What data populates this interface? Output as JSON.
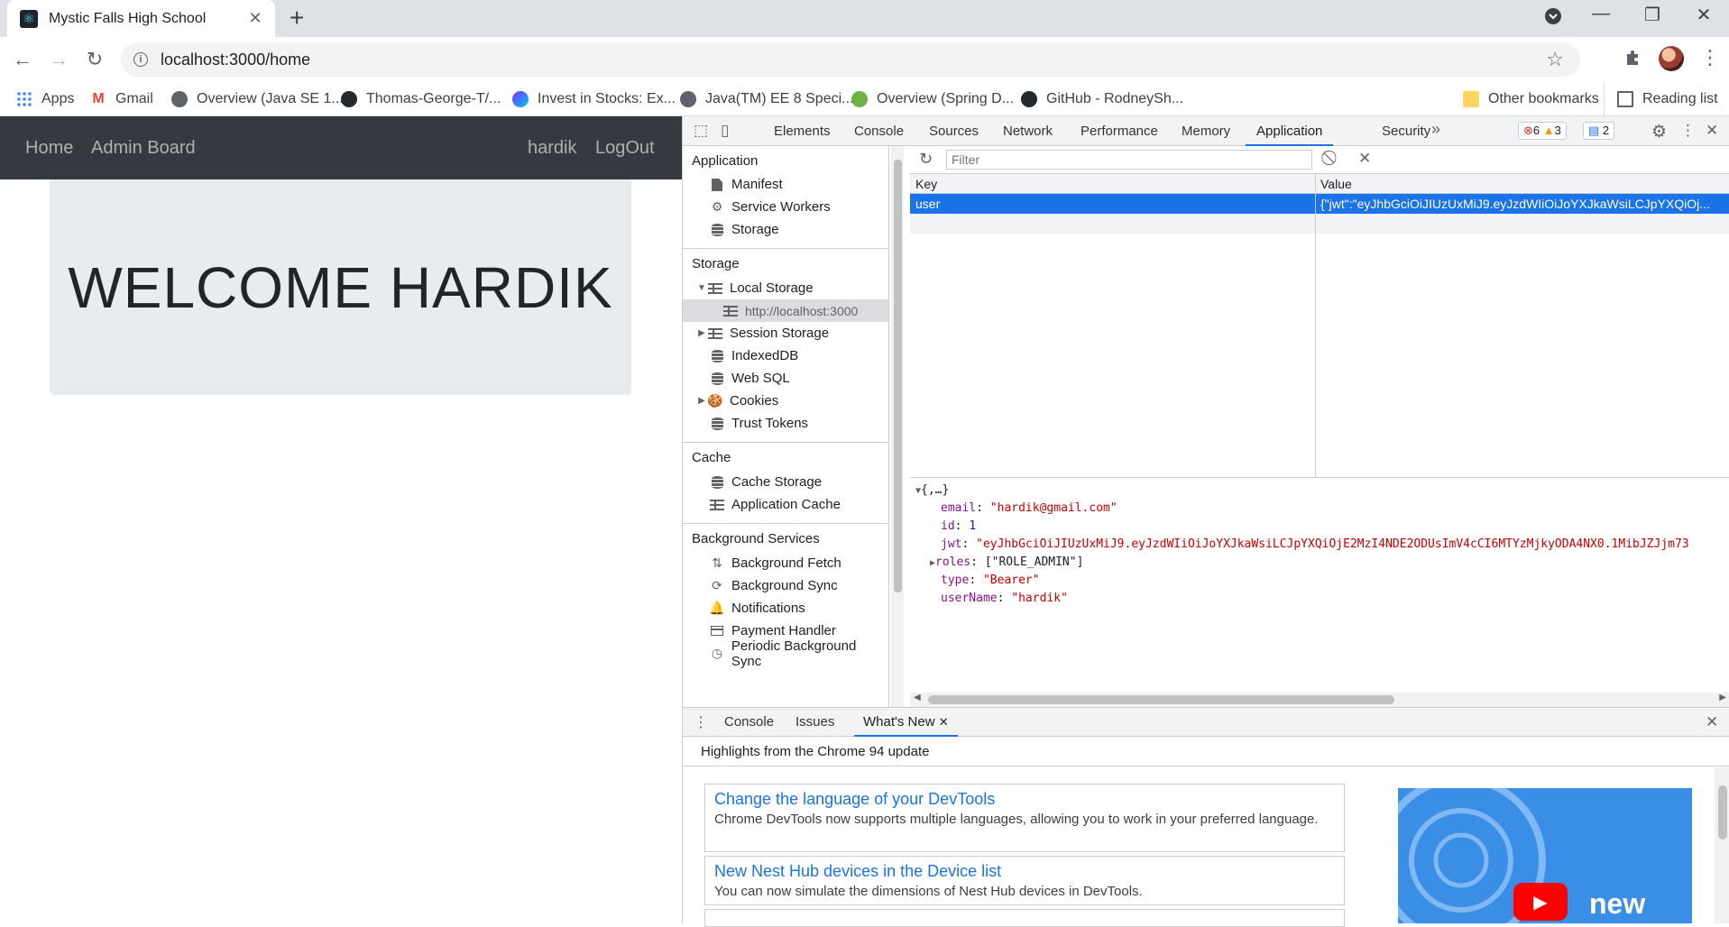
{
  "browser": {
    "tab_title": "Mystic Falls High School",
    "url": "localhost:3000/home",
    "bookmarks": [
      {
        "label": "Apps",
        "icon": "apps-grid-icon"
      },
      {
        "label": "Gmail",
        "icon": "gmail-icon"
      },
      {
        "label": "Overview (Java SE 1...",
        "icon": "globe-icon"
      },
      {
        "label": "Thomas-George-T/...",
        "icon": "github-icon"
      },
      {
        "label": "Invest in Stocks: Ex...",
        "icon": "invest-icon"
      },
      {
        "label": "Java(TM) EE 8 Speci...",
        "icon": "globe-icon"
      },
      {
        "label": "Overview (Spring D...",
        "icon": "spring-icon"
      },
      {
        "label": "GitHub - RodneySh...",
        "icon": "github-icon"
      }
    ],
    "other_bookmarks": "Other bookmarks",
    "reading_list": "Reading list"
  },
  "page": {
    "nav": {
      "home": "Home",
      "admin": "Admin Board",
      "user": "hardik",
      "logout": "LogOut"
    },
    "welcome": "WELCOME HARDIK"
  },
  "devtools": {
    "tabs": [
      "Elements",
      "Console",
      "Sources",
      "Network",
      "Performance",
      "Memory",
      "Application",
      "Security"
    ],
    "active_tab": "Application",
    "errors": "6",
    "warnings": "3",
    "messages": "2",
    "sidebar": {
      "application_header": "Application",
      "application_items": [
        "Manifest",
        "Service Workers",
        "Storage"
      ],
      "storage_header": "Storage",
      "local_storage": "Local Storage",
      "local_storage_child": "http://localhost:3000",
      "storage_items": [
        "Session Storage",
        "IndexedDB",
        "Web SQL",
        "Cookies",
        "Trust Tokens"
      ],
      "cache_header": "Cache",
      "cache_items": [
        "Cache Storage",
        "Application Cache"
      ],
      "bg_header": "Background Services",
      "bg_items": [
        "Background Fetch",
        "Background Sync",
        "Notifications",
        "Payment Handler",
        "Periodic Background Sync"
      ]
    },
    "filter_placeholder": "Filter",
    "table": {
      "key_header": "Key",
      "value_header": "Value",
      "rows": [
        {
          "key": "user",
          "value": "{\"jwt\":\"eyJhbGciOiJIUzUxMiJ9.eyJzdWIiOiJoYXJkaWsiLCJpYXQiOj..."
        }
      ]
    },
    "preview": {
      "root": "{,…}",
      "email_key": "email",
      "email_val": "\"hardik@gmail.com\"",
      "id_key": "id",
      "id_val": "1",
      "jwt_key": "jwt",
      "jwt_val": "\"eyJhbGciOiJIUzUxMiJ9.eyJzdWIiOiJoYXJkaWsiLCJpYXQiOjE2MzI4NDE2ODUsImV4cCI6MTYzMjkyODA4NX0.1MibJZJjm73",
      "roles_key": "roles",
      "roles_val": "[\"ROLE_ADMIN\"]",
      "type_key": "type",
      "type_val": "\"Bearer\"",
      "username_key": "userName",
      "username_val": "\"hardik\""
    },
    "drawer": {
      "tabs": [
        "Console",
        "Issues",
        "What's New"
      ],
      "highlights": "Highlights from the Chrome 94 update",
      "cards": [
        {
          "title": "Change the language of your DevTools",
          "desc": "Chrome DevTools now supports multiple languages, allowing you to work in your preferred language."
        },
        {
          "title": "New Nest Hub devices in the Device list",
          "desc": "You can now simulate the dimensions of Nest Hub devices in DevTools."
        }
      ],
      "video_label": "new"
    }
  }
}
